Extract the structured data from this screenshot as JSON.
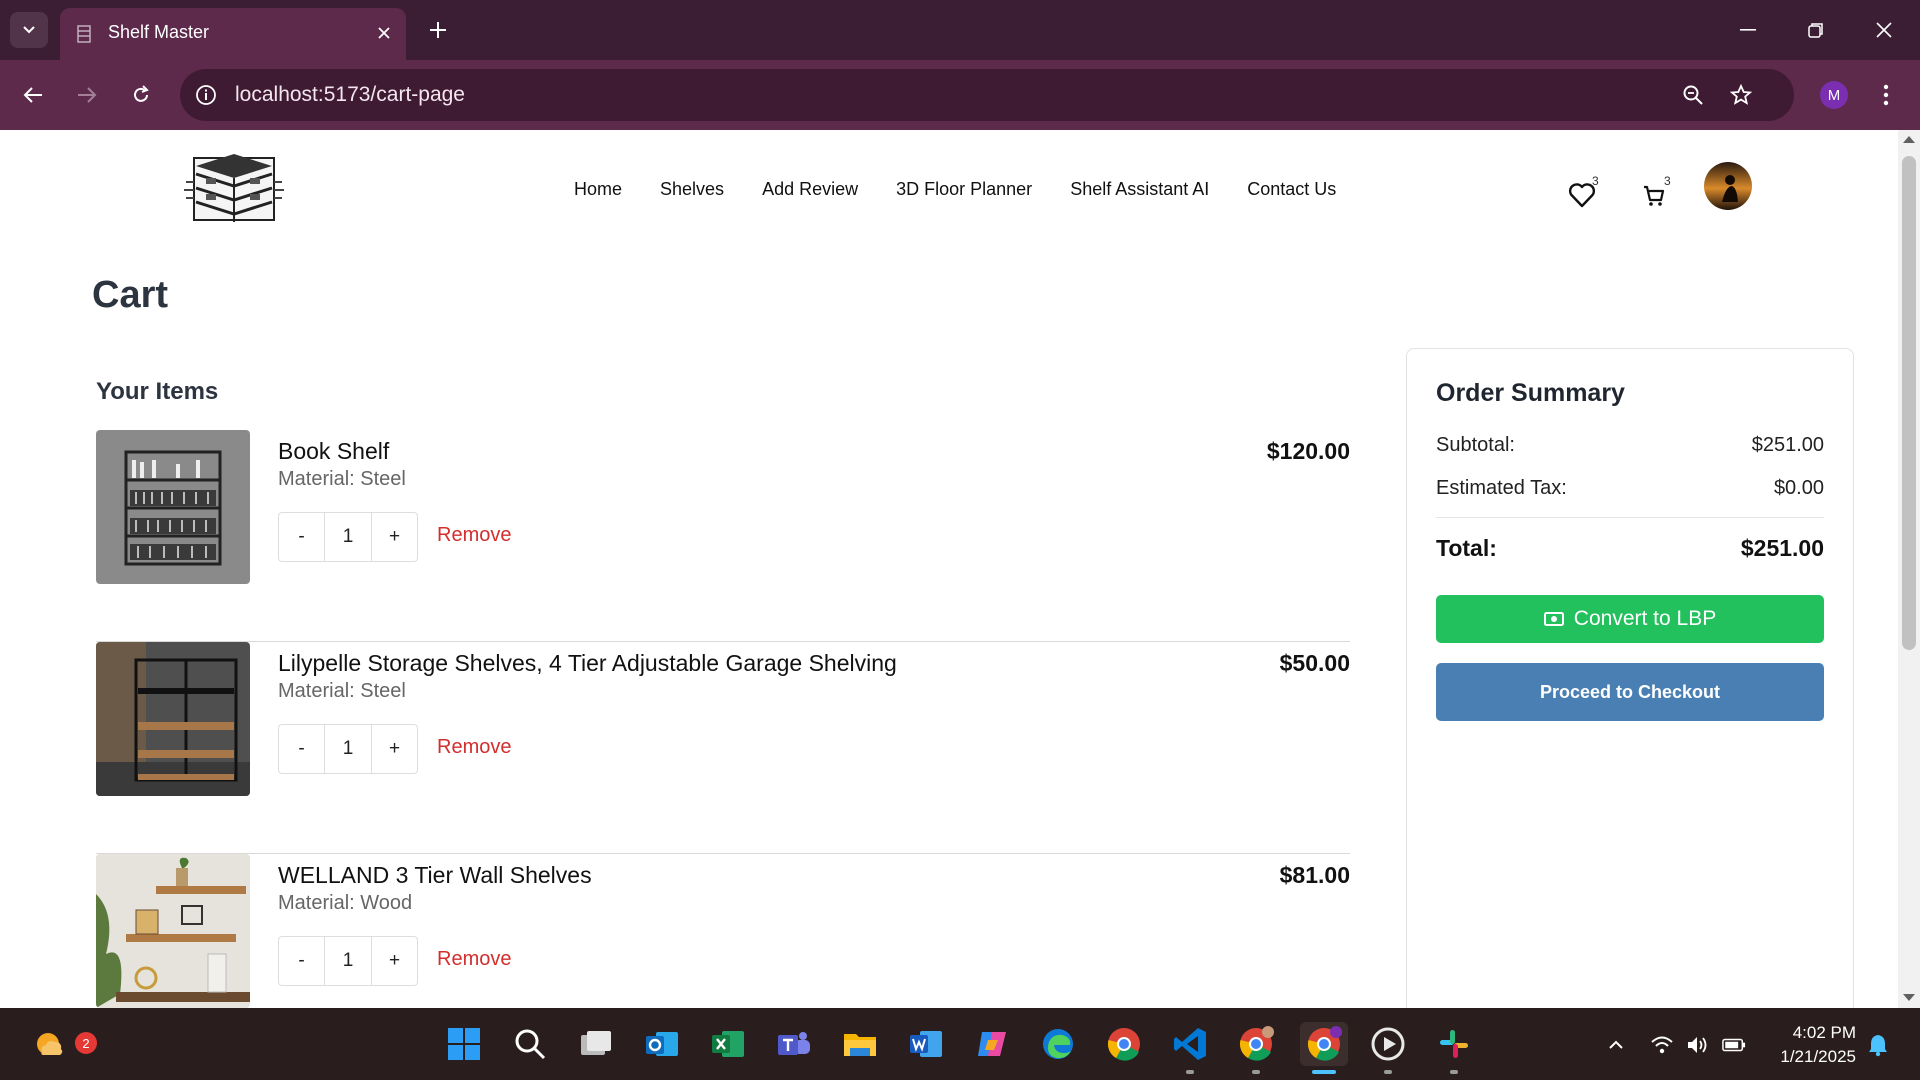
{
  "browser": {
    "tab_title": "Shelf Master",
    "url": "localhost:5173/cart-page",
    "profile_initial": "M"
  },
  "nav": {
    "links": [
      "Home",
      "Shelves",
      "Add Review",
      "3D Floor Planner",
      "Shelf Assistant AI",
      "Contact Us"
    ],
    "wishlist_count": "3",
    "cart_count": "3"
  },
  "cart": {
    "title": "Cart",
    "items_heading": "Your Items",
    "remove_label": "Remove",
    "decrement_label": "-",
    "increment_label": "+",
    "items": [
      {
        "name": "Book Shelf",
        "material": "Material: Steel",
        "price": "$120.00",
        "quantity": "1"
      },
      {
        "name": "Lilypelle Storage Shelves, 4 Tier Adjustable Garage Shelving",
        "material": "Material: Steel",
        "price": "$50.00",
        "quantity": "1"
      },
      {
        "name": "WELLAND 3 Tier Wall Shelves",
        "material": "Material: Wood",
        "price": "$81.00",
        "quantity": "1"
      }
    ]
  },
  "summary": {
    "title": "Order Summary",
    "subtotal_label": "Subtotal:",
    "subtotal_value": "$251.00",
    "tax_label": "Estimated Tax:",
    "tax_value": "$0.00",
    "total_label": "Total:",
    "total_value": "$251.00",
    "convert_label": "Convert to LBP",
    "checkout_label": "Proceed to Checkout"
  },
  "taskbar": {
    "weather_badge": "2",
    "time": "4:02 PM",
    "date": "1/21/2025"
  },
  "colors": {
    "chrome_dark": "#3b1e33",
    "chrome_toolbar": "#5d2a4c",
    "remove_red": "#d32f2f",
    "convert_green": "#22c15e",
    "checkout_blue": "#4a7fb4"
  }
}
